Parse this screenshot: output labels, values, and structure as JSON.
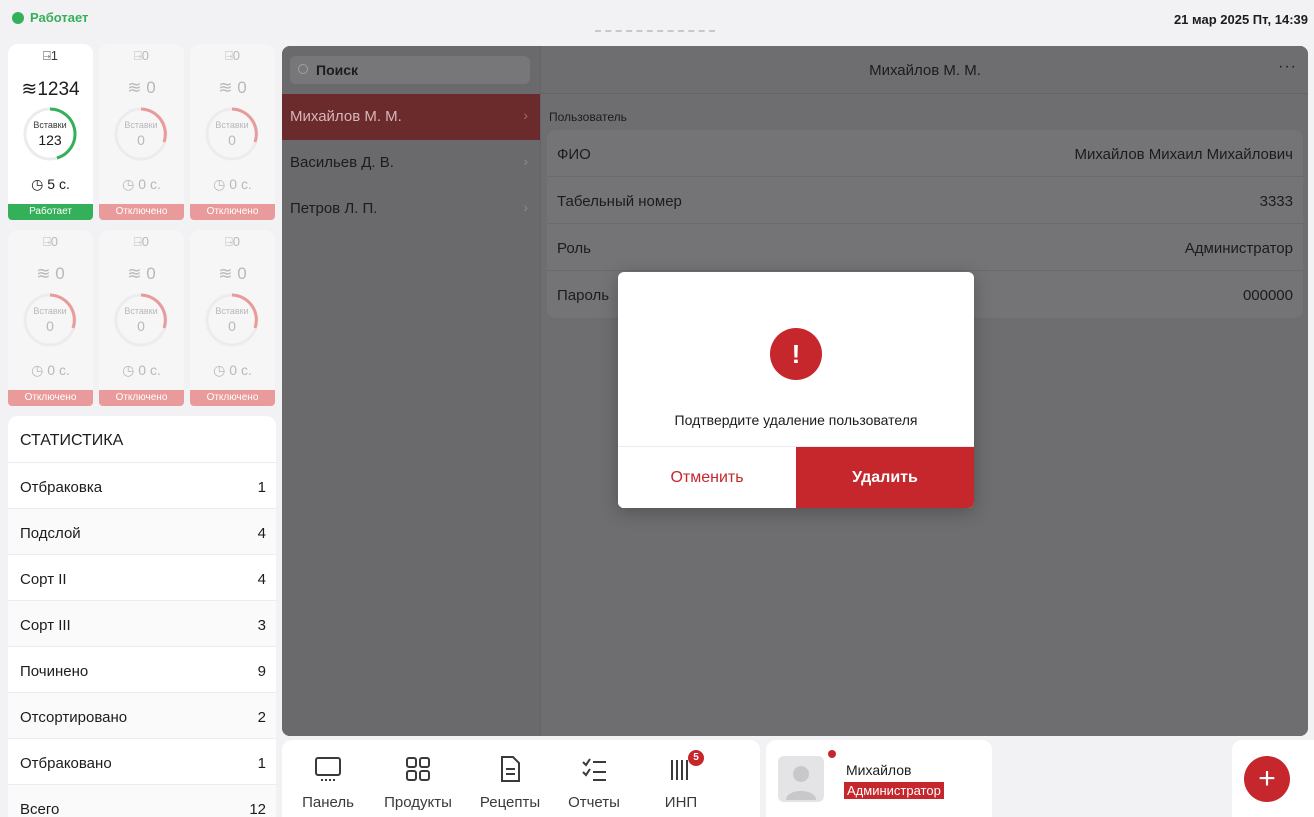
{
  "status": {
    "state_text": "Работает",
    "datetime": "21 мар 2025 Пт, 14:39",
    "state_color": "#34b05a"
  },
  "devices": [
    {
      "code": "1",
      "count": "1234",
      "gauge_label": "Вставки",
      "gauge_value": "123",
      "time": "5 с.",
      "state": "Работает",
      "on": true
    },
    {
      "code": "0",
      "count": "0",
      "gauge_label": "Вставки",
      "gauge_value": "0",
      "time": "0 с.",
      "state": "Отключено",
      "on": false
    },
    {
      "code": "0",
      "count": "0",
      "gauge_label": "Вставки",
      "gauge_value": "0",
      "time": "0 с.",
      "state": "Отключено",
      "on": false
    },
    {
      "code": "0",
      "count": "0",
      "gauge_label": "Вставки",
      "gauge_value": "0",
      "time": "0 с.",
      "state": "Отключено",
      "on": false
    },
    {
      "code": "0",
      "count": "0",
      "gauge_label": "Вставки",
      "gauge_value": "0",
      "time": "0 с.",
      "state": "Отключено",
      "on": false
    },
    {
      "code": "0",
      "count": "0",
      "gauge_label": "Вставки",
      "gauge_value": "0",
      "time": "0 с.",
      "state": "Отключено",
      "on": false
    }
  ],
  "statistics": {
    "title": "СТАТИСТИКА",
    "rows": [
      {
        "label": "Отбраковка",
        "value": "1"
      },
      {
        "label": "Подслой",
        "value": "4"
      },
      {
        "label": "Сорт II",
        "value": "4"
      },
      {
        "label": "Сорт III",
        "value": "3"
      },
      {
        "label": "Починено",
        "value": "9"
      },
      {
        "label": "Отсортировано",
        "value": "2"
      },
      {
        "label": "Отбраковано",
        "value": "1"
      },
      {
        "label": "Всего",
        "value": "12"
      }
    ]
  },
  "users": {
    "search_placeholder": "Поиск",
    "items": [
      {
        "name": "Михайлов М. М.",
        "selected": true
      },
      {
        "name": "Васильев Д. В.",
        "selected": false
      },
      {
        "name": "Петров Л. П.",
        "selected": false
      }
    ]
  },
  "detail": {
    "title": "Михайлов М. М.",
    "more": "···",
    "section": "Пользователь",
    "fields": [
      {
        "label": "ФИО",
        "value": "Михайлов Михаил Михайлович"
      },
      {
        "label": "Табельный номер",
        "value": "3333"
      },
      {
        "label": "Роль",
        "value": "Администратор"
      },
      {
        "label": "Пароль",
        "value": "000000"
      }
    ]
  },
  "modal": {
    "icon": "!",
    "message": "Подтвердите удаление пользователя",
    "cancel_label": "Отменить",
    "delete_label": "Удалить"
  },
  "tabs": [
    {
      "label": "Панель",
      "icon": "monitor-icon"
    },
    {
      "label": "Продукты",
      "icon": "grid-icon"
    },
    {
      "label": "Рецепты",
      "icon": "document-icon"
    },
    {
      "label": "Отчеты",
      "icon": "checklist-icon"
    },
    {
      "label": "ИНП",
      "icon": "barcode-icon",
      "badge": "5"
    }
  ],
  "current_user": {
    "name": "Михайлов",
    "role": "Администратор"
  },
  "fab": {
    "label": "+"
  },
  "colors": {
    "accent": "#c5272d",
    "success": "#34b05a",
    "overlay": "#6e6e70"
  }
}
